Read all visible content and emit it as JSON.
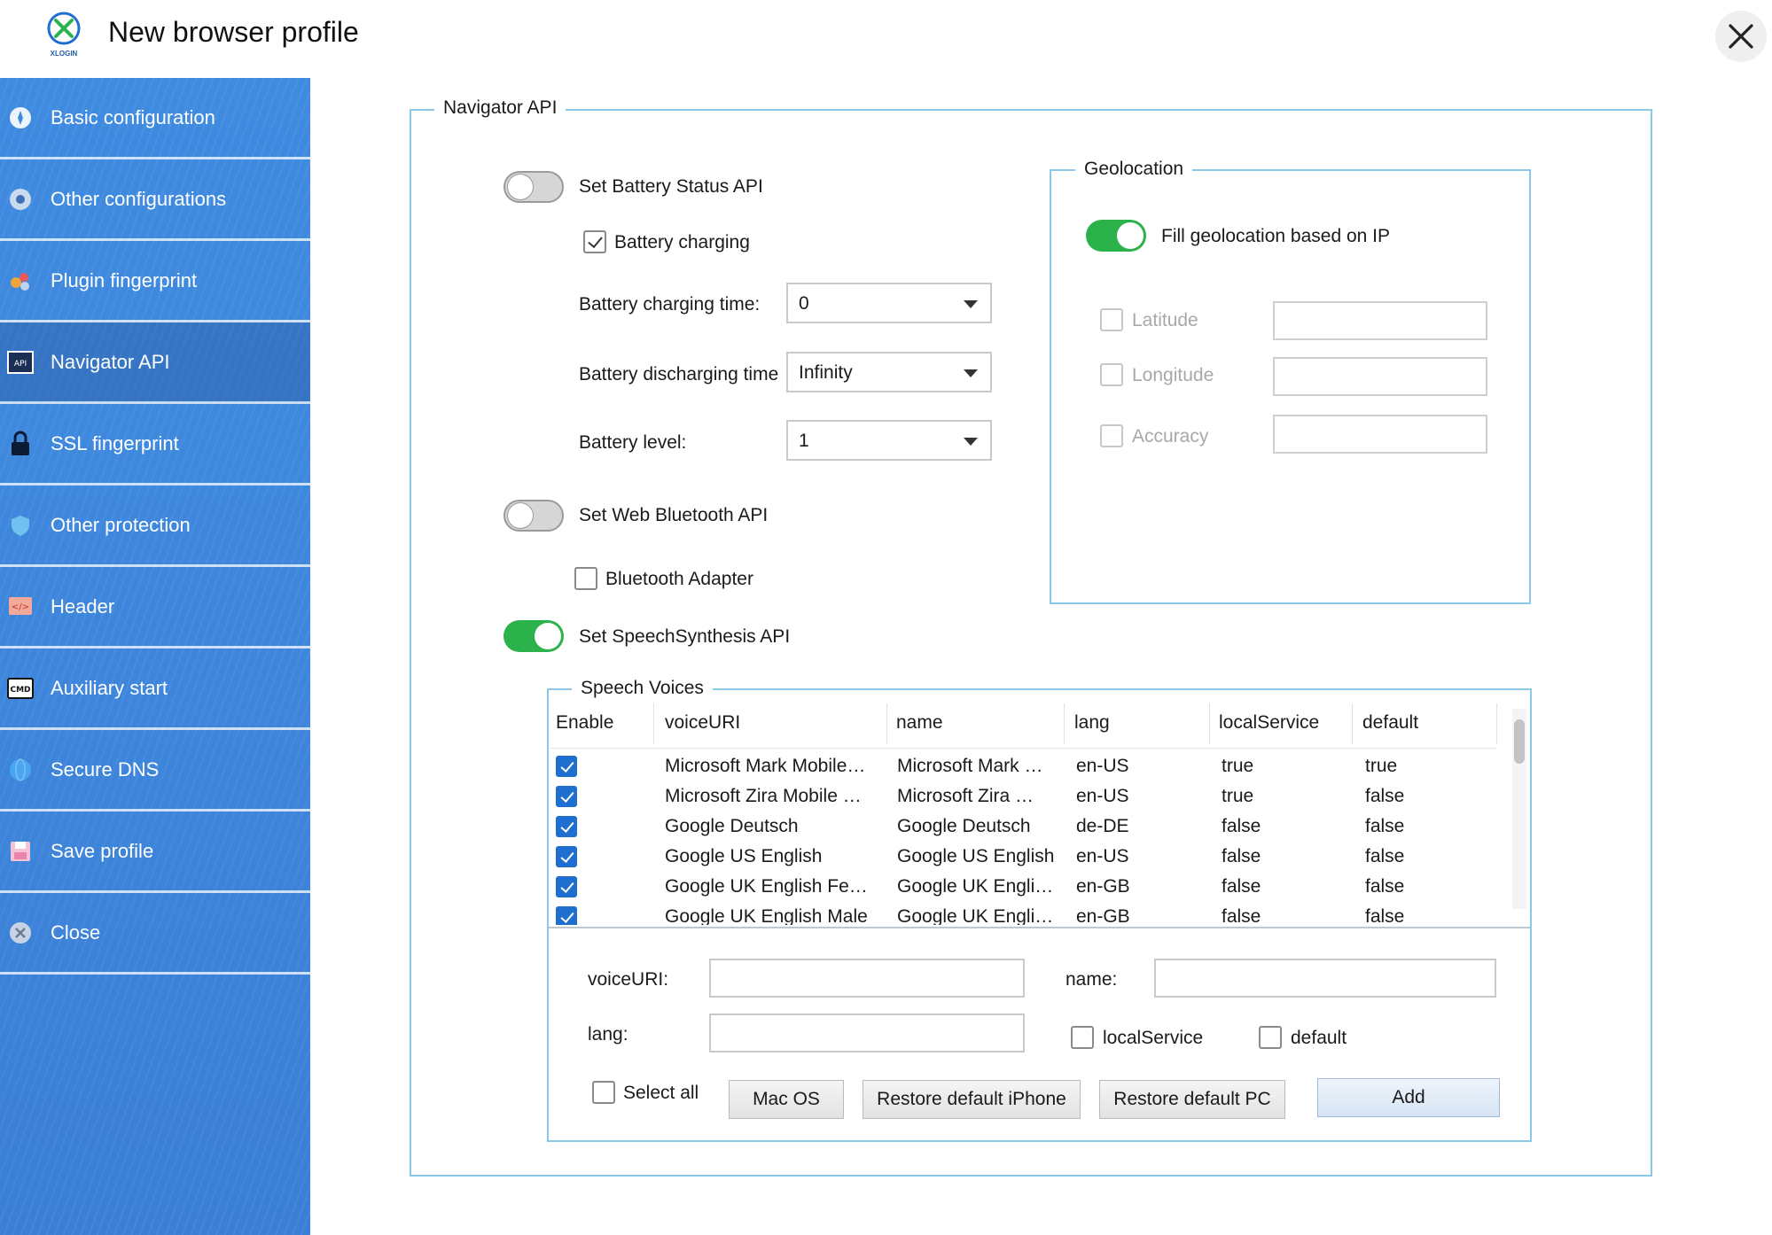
{
  "window": {
    "title": "New browser profile",
    "logo_text": "XLOGIN",
    "logo_icon": "xlogin-logo-icon",
    "close_icon": "close-icon"
  },
  "colors": {
    "sidebar": "#3f8be0",
    "toggle_on": "#2cb24a",
    "group_border": "#8cc8e6",
    "checkbox_blue": "#1f6fd0"
  },
  "sidebar": {
    "items": [
      {
        "label": "Basic configuration",
        "icon": "compass-icon",
        "active": false
      },
      {
        "label": "Other configurations",
        "icon": "chrome-icon",
        "active": false
      },
      {
        "label": "Plugin fingerprint",
        "icon": "puzzle-icon",
        "active": false
      },
      {
        "label": "Navigator API",
        "icon": "api-icon",
        "active": true
      },
      {
        "label": "SSL fingerprint",
        "icon": "lock-icon",
        "active": false
      },
      {
        "label": "Other protection",
        "icon": "shield-icon",
        "active": false
      },
      {
        "label": "Header",
        "icon": "code-icon",
        "active": false
      },
      {
        "label": "Auxiliary start",
        "icon": "cmd-icon",
        "active": false
      },
      {
        "label": "Secure DNS",
        "icon": "globe-icon",
        "active": false
      },
      {
        "label": "Save profile",
        "icon": "save-icon",
        "active": false
      },
      {
        "label": "Close",
        "icon": "close-circle-icon",
        "active": false
      }
    ]
  },
  "navigator": {
    "group_title": "Navigator API",
    "battery": {
      "toggle_label": "Set Battery Status API",
      "toggle_on": false,
      "charging_label": "Battery charging",
      "charging_checked": true,
      "charging_time_label": "Battery charging time:",
      "charging_time_value": "0",
      "discharging_time_label": "Battery discharging time",
      "discharging_time_value": "Infinity",
      "level_label": "Battery level:",
      "level_value": "1"
    },
    "bluetooth": {
      "toggle_label": "Set Web Bluetooth API",
      "toggle_on": false,
      "adapter_label": "Bluetooth Adapter",
      "adapter_checked": false
    },
    "speech": {
      "toggle_label": "Set SpeechSynthesis API",
      "toggle_on": true
    }
  },
  "geolocation": {
    "group_title": "Geolocation",
    "fill_label": "Fill geolocation based on IP",
    "fill_on": true,
    "latitude_label": "Latitude",
    "longitude_label": "Longitude",
    "accuracy_label": "Accuracy"
  },
  "voices": {
    "group_title": "Speech Voices",
    "columns": [
      "Enable",
      "voiceURI",
      "name",
      "lang",
      "localService",
      "default"
    ],
    "rows": [
      {
        "enabled": true,
        "voiceURI": "Microsoft Mark Mobile…",
        "name": "Microsoft Mark …",
        "lang": "en-US",
        "localService": "true",
        "default": "true"
      },
      {
        "enabled": true,
        "voiceURI": "Microsoft Zira Mobile …",
        "name": "Microsoft Zira …",
        "lang": "en-US",
        "localService": "true",
        "default": "false"
      },
      {
        "enabled": true,
        "voiceURI": "Google Deutsch",
        "name": "Google Deutsch",
        "lang": "de-DE",
        "localService": "false",
        "default": "false"
      },
      {
        "enabled": true,
        "voiceURI": "Google US English",
        "name": "Google US English",
        "lang": "en-US",
        "localService": "false",
        "default": "false"
      },
      {
        "enabled": true,
        "voiceURI": "Google UK English Fe…",
        "name": "Google UK Engli…",
        "lang": "en-GB",
        "localService": "false",
        "default": "false"
      },
      {
        "enabled": true,
        "voiceURI": "Google UK English Male",
        "name": "Google UK Engli…",
        "lang": "en-GB",
        "localService": "false",
        "default": "false"
      }
    ],
    "form": {
      "voiceuri_label": "voiceURI:",
      "name_label": "name:",
      "lang_label": "lang:",
      "local_service_label": "localService",
      "default_label": "default",
      "select_all_label": "Select all",
      "mac_os_button": "Mac OS",
      "restore_iphone_button": "Restore default iPhone",
      "restore_pc_button": "Restore default PC",
      "add_button": "Add"
    }
  }
}
